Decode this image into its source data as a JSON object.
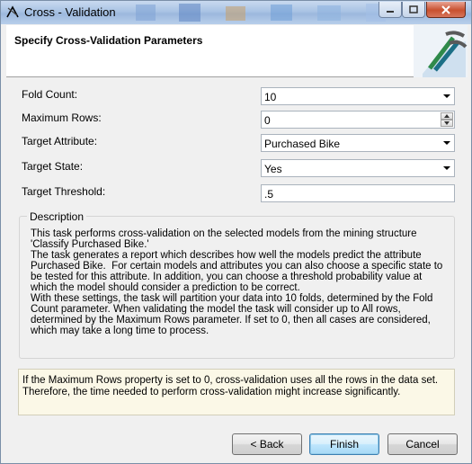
{
  "window": {
    "title": "Cross - Validation"
  },
  "header": {
    "title": "Specify Cross-Validation Parameters"
  },
  "form": {
    "fold_count": {
      "label": "Fold Count:",
      "value": "10"
    },
    "maximum_rows": {
      "label": "Maximum Rows:",
      "value": "0"
    },
    "target_attribute": {
      "label": "Target Attribute:",
      "value": "Purchased Bike"
    },
    "target_state": {
      "label": "Target State:",
      "value": "Yes"
    },
    "target_threshold": {
      "label": "Target Threshold:",
      "value": ".5"
    }
  },
  "description": {
    "legend": "Description",
    "text": "This task performs cross-validation on the selected models from the mining structure 'Classify Purchased Bike.'\nThe task generates a report which describes how well the models predict the attribute Purchased Bike.  For certain models and attributes you can also choose a specific state to be tested for this attribute. In addition, you can choose a threshold probability value at which the model should consider a prediction to be correct.\nWith these settings, the task will partition your data into 10 folds, determined by the Fold Count parameter. When validating the model the task will consider up to All rows, determined by the Maximum Rows parameter. If set to 0, then all cases are considered, which may take a long time to process."
  },
  "warning": "If the Maximum Rows property is set to 0, cross-validation uses all the rows in the data set. Therefore, the time needed to perform cross-validation might increase significantly.",
  "buttons": {
    "back": "< Back",
    "finish": "Finish",
    "cancel": "Cancel"
  },
  "icons": {
    "app": "cross-validation-app-icon",
    "minimize": "minimize-icon",
    "maximize": "maximize-icon",
    "close": "close-icon",
    "logo": "mining-wizard-logo-icon"
  }
}
